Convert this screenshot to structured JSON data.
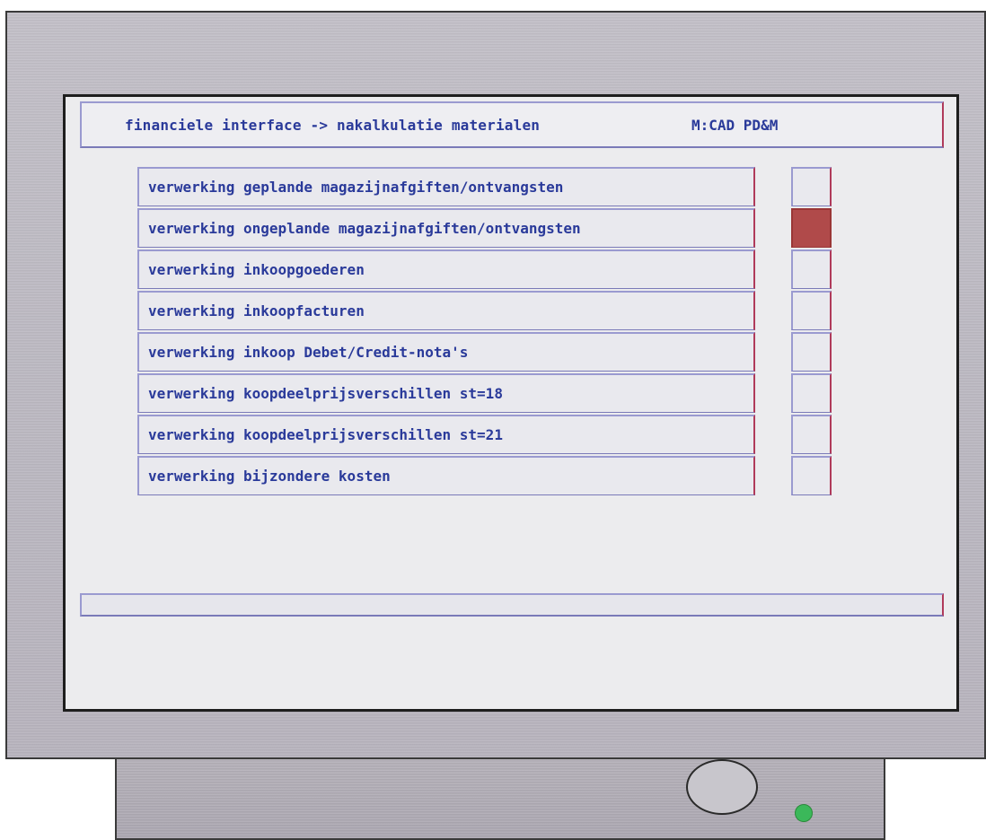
{
  "screen": {
    "title": "financiele interface -> nakalkulatie materialen",
    "system_code": "M:CAD PD&M",
    "status_text": ""
  },
  "menu": {
    "items": [
      {
        "label": "verwerking geplande magazijnafgiften/ontvangsten",
        "selected": false
      },
      {
        "label": "verwerking ongeplande magazijnafgiften/ontvangsten",
        "selected": true
      },
      {
        "label": "verwerking inkoopgoederen",
        "selected": false
      },
      {
        "label": "verwerking inkoopfacturen",
        "selected": false
      },
      {
        "label": "verwerking inkoop Debet/Credit-nota's",
        "selected": false
      },
      {
        "label": "verwerking koopdeelprijsverschillen st=18",
        "selected": false
      },
      {
        "label": "verwerking koopdeelprijsverschillen st=21",
        "selected": false
      },
      {
        "label": "verwerking bijzondere kosten",
        "selected": false
      }
    ]
  },
  "colors": {
    "text": "#2a3a9a",
    "selection": "#b04a4a",
    "screen_bg": "#ececee",
    "bezel": "#bdbac3",
    "power_led": "#3bb85a"
  },
  "icons": {
    "power_button": "power-button-icon",
    "power_led": "led-indicator-icon"
  }
}
